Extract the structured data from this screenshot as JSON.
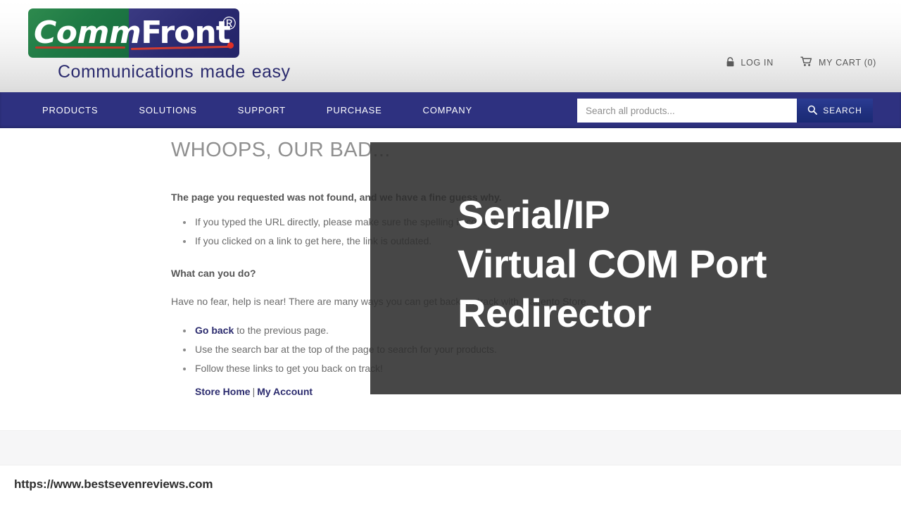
{
  "site": {
    "logo": {
      "word_part1": "Comm",
      "word_part2": "Front",
      "registered_mark": "®",
      "tagline_1": "Communications",
      "tagline_2": "made",
      "tagline_3": "easy"
    },
    "header_links": [
      {
        "icon": "lock-icon",
        "label": "LOG IN"
      },
      {
        "icon": "cart-icon",
        "label": "MY CART (0)"
      }
    ],
    "nav": [
      {
        "label": "PRODUCTS"
      },
      {
        "label": "SOLUTIONS"
      },
      {
        "label": "SUPPORT"
      },
      {
        "label": "PURCHASE"
      },
      {
        "label": "COMPANY"
      }
    ],
    "search": {
      "placeholder": "Search all products...",
      "value": "",
      "button_label": "SEARCH",
      "icon": "magnifier-icon"
    }
  },
  "main": {
    "title": "WHOOPS, OUR BAD...",
    "lead": "The page you requested was not found, and we have a fine guess why.",
    "reasons": [
      "If you typed the URL directly, please make sure the spelling is correct.",
      "If you clicked on a link to get here, the link is outdated."
    ],
    "subhead": "What can you do?",
    "paragraph": "Have no fear, help is near! There are many ways you can get back on track with Magento Store.",
    "actions": {
      "go_back_link": "Go back",
      "go_back_rest": " to the previous page.",
      "search_tip": "Use the search bar at the top of the page to search for your products.",
      "follow_links": "Follow these links to get you back on track!",
      "store_home_link": "Store Home",
      "separator": "|",
      "my_account_link": "My Account"
    }
  },
  "overlay": {
    "headline": "Serial/IP\nVirtual COM Port\nRedirector",
    "background_color": "#2d2d2d"
  },
  "browser": {
    "url": "https://www.bestsevenreviews.com"
  },
  "colors": {
    "nav_bar": "#2e3180",
    "logo_green": "#1f7a45",
    "logo_navy": "#2b2b72",
    "link": "#2b2b6e",
    "title_gray": "#8f8f8f"
  }
}
